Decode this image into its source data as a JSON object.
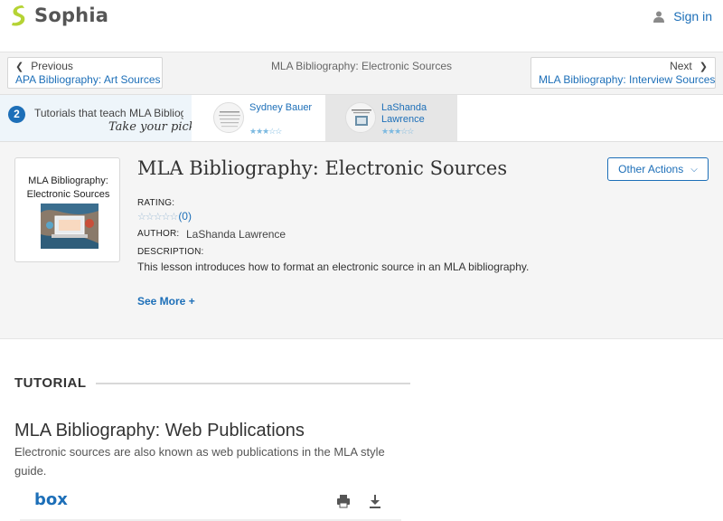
{
  "header": {
    "logo_text": "Sophia",
    "signin_label": "Sign in"
  },
  "nav": {
    "prev_small": "Previous",
    "prev_link": "APA Bibliography: Art Sources",
    "center_title": "MLA Bibliography: Electronic Sources",
    "next_small": "Next",
    "next_link": "MLA Bibliography: Interview Sources"
  },
  "tutorials": {
    "count": "2",
    "title": "Tutorials that teach MLA Bibliog",
    "pick": "Take your pick:",
    "cards": [
      {
        "name": "Sydney Bauer",
        "rating": 3
      },
      {
        "name": "LaShanda Lawrence",
        "rating": 3
      }
    ]
  },
  "lesson": {
    "cover_title": "MLA Bibliography: Electronic Sources",
    "title": "MLA Bibliography: Electronic Sources",
    "actions_label": "Other Actions",
    "rating_label": "RATING:",
    "rating_stars": "☆☆☆☆☆",
    "rating_count": "(0)",
    "author_label": "AUTHOR:",
    "author": "LaShanda Lawrence",
    "description_label": "DESCRIPTION:",
    "description": "This lesson introduces how to format an electronic source in an MLA bibliography.",
    "see_more": "See More +"
  },
  "tutorial": {
    "section_label": "TUTORIAL",
    "title": "MLA Bibliography: Web Publications",
    "description": "Electronic sources are also known as web publications in the MLA style guide.",
    "viewer_brand": "box"
  },
  "colors": {
    "brand_green": "#b5d334",
    "link_blue": "#1d6fb8"
  }
}
